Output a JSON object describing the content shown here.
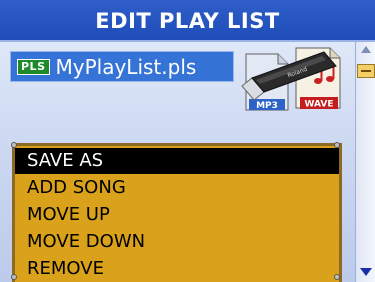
{
  "title": "EDIT PLAY LIST",
  "file": {
    "badge": "PLS",
    "name": "MyPlayList.pls"
  },
  "media": {
    "usb_brand": "Roland",
    "mp3_label": "MP3",
    "wave_label": "WAVE"
  },
  "menu": {
    "selected_index": 0,
    "items": [
      "SAVE AS",
      "ADD SONG",
      "MOVE UP",
      "MOVE DOWN",
      "REMOVE"
    ]
  },
  "colors": {
    "title_bar": "#2f5ec9",
    "file_box": "#3573d6",
    "menu_bg": "#d9a21a",
    "selected_bg": "#000000"
  },
  "icons": {
    "usb": "usb-stick-icon",
    "mp3": "mp3-file-icon",
    "wave": "wave-file-icon",
    "scroll_up": "scroll-up-arrow-icon",
    "scroll_down": "scroll-down-arrow-icon"
  }
}
